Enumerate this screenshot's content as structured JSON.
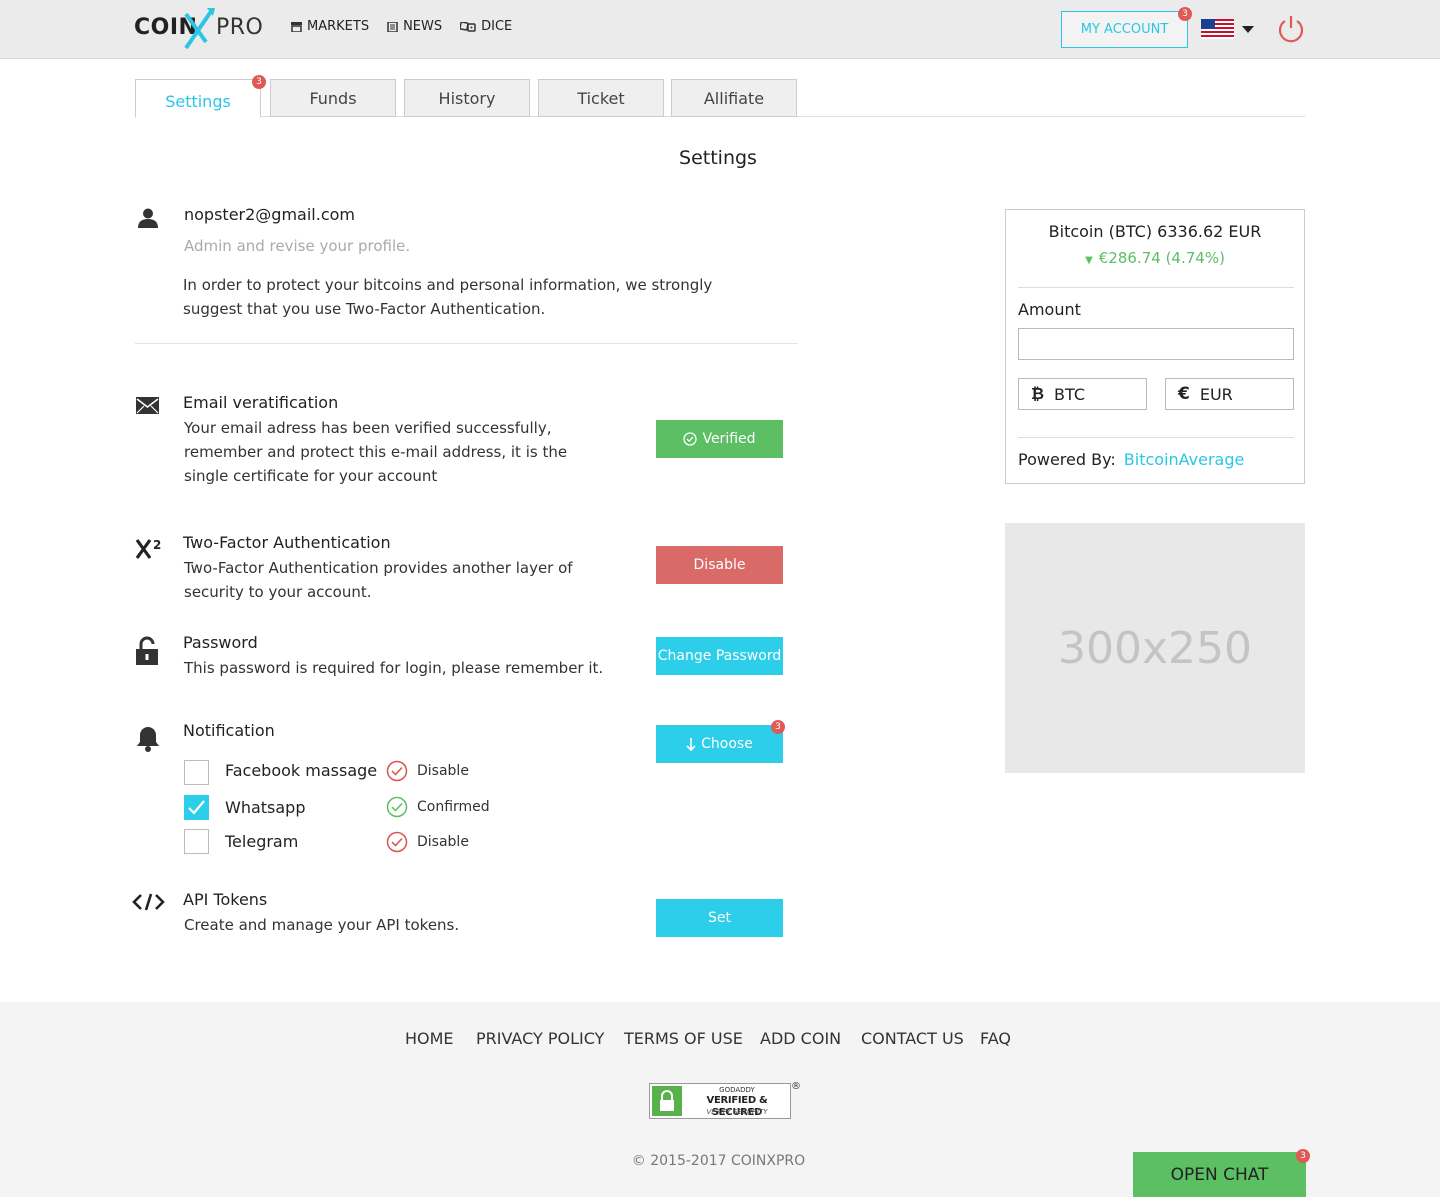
{
  "brand": {
    "logo_left": "COIN",
    "logo_right": "PRO"
  },
  "header": {
    "nav": [
      {
        "label": "MARKETS",
        "icon": "store-icon"
      },
      {
        "label": "NEWS",
        "icon": "newspaper-icon"
      },
      {
        "label": "DICE",
        "icon": "dice-icon"
      }
    ],
    "account_label": "MY ACCOUNT",
    "account_badge": "3",
    "language": "us-flag-icon"
  },
  "tabs": [
    {
      "label": "Settings",
      "active": true,
      "badge": "3"
    },
    {
      "label": "Funds"
    },
    {
      "label": "History"
    },
    {
      "label": "Ticket"
    },
    {
      "label": "Allifiate"
    }
  ],
  "page_title": "Settings",
  "profile": {
    "email": "nopster2@gmail.com",
    "subtitle": "Admin and revise your profile.",
    "notice_line1": "In order to protect your bitcoins and personal information, we strongly",
    "notice_line2": "suggest that you use Two-Factor Authentication."
  },
  "sections": {
    "email_verification": {
      "title": "Email veratification",
      "line1": "Your email adress has been verified successfully,",
      "line2": "remember and protect this e-mail address, it is the",
      "line3": "single certificate for your account",
      "button": "Verified"
    },
    "two_factor": {
      "title": "Two-Factor Authentication",
      "line1": "Two-Factor Authentication provides another layer of",
      "line2": "security to your account.",
      "button": "Disable"
    },
    "password": {
      "title": "Password",
      "line1": "This password is required for login, please remember it.",
      "button": "Change Password"
    },
    "notification": {
      "title": "Notification",
      "button": "Choose",
      "button_badge": "3",
      "channels": [
        {
          "label": "Facebook massage",
          "checked": false,
          "status": "Disable"
        },
        {
          "label": "Whatsapp",
          "checked": true,
          "status": "Confirmed"
        },
        {
          "label": "Telegram",
          "checked": false,
          "status": "Disable"
        }
      ]
    },
    "api_tokens": {
      "title": "API Tokens",
      "line1": "Create and manage your API tokens.",
      "button": "Set"
    }
  },
  "widget": {
    "title": "Bitcoin (BTC) 6336.62 EUR",
    "change": "€286.74 (4.74%)",
    "amount_label": "Amount",
    "amount_value": "",
    "currency_a": "BTC",
    "currency_b": "EUR",
    "powered_label": "Powered By:",
    "powered_link": "BitcoinAverage"
  },
  "ad": {
    "label": "300x250"
  },
  "footer": {
    "links": [
      "HOME",
      "PRIVACY POLICY",
      "TERMS OF USE",
      "ADD COIN",
      "CONTACT US",
      "FAQ"
    ],
    "seal_line1": "GODADDY",
    "seal_line2": "VERIFIED & SECURED",
    "seal_line3": "VERIFY SECURITY",
    "copyright": "© 2015-2017 COINXPRO",
    "chat_label": "OPEN CHAT",
    "chat_badge": "3"
  },
  "colors": {
    "accent": "#2bc6e6",
    "success": "#5cbf63",
    "danger": "#d96a68",
    "badge": "#e05a55"
  }
}
